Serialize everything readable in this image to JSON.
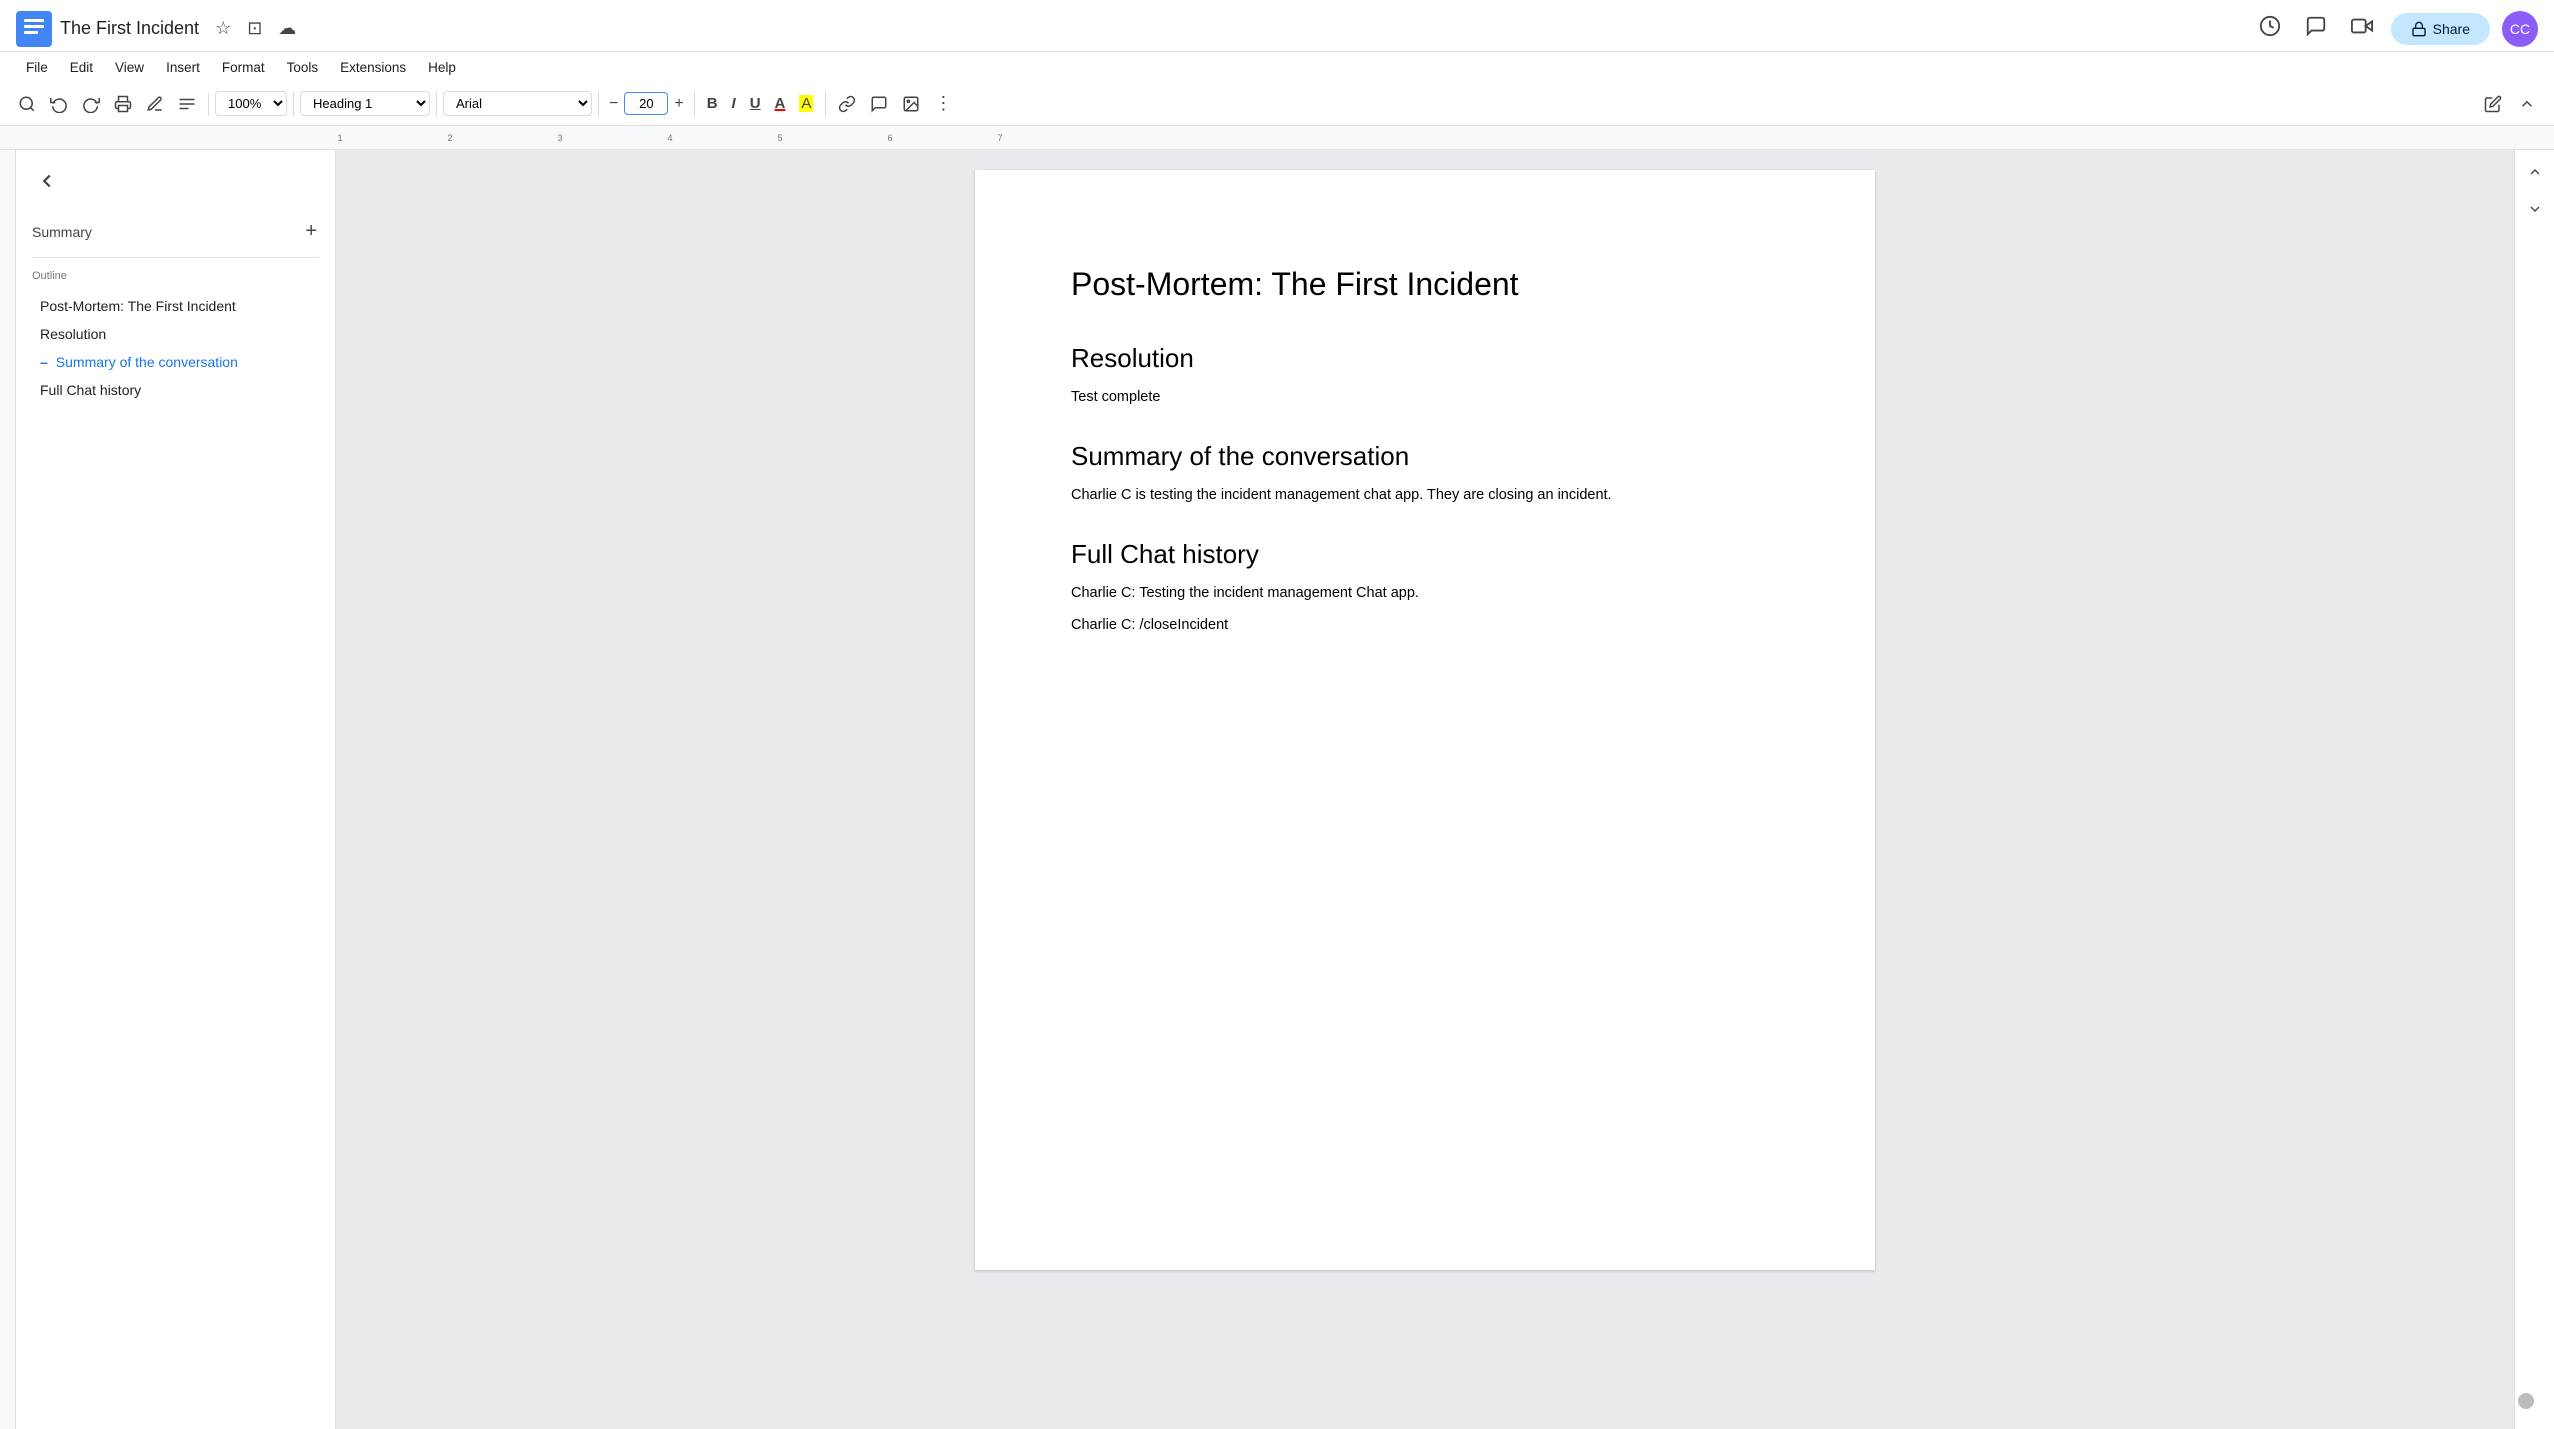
{
  "app": {
    "title": "The First Incident",
    "docs_logo_color": "#4285f4"
  },
  "titlebar": {
    "title": "The First Incident",
    "star_label": "☆",
    "folder_label": "⊡",
    "cloud_label": "☁",
    "history_icon": "history",
    "comment_icon": "comment",
    "video_icon": "video",
    "share_label": "Share",
    "avatar_initials": "CC"
  },
  "menubar": {
    "items": [
      "File",
      "Edit",
      "View",
      "Insert",
      "Format",
      "Tools",
      "Extensions",
      "Help"
    ]
  },
  "toolbar": {
    "search_icon": "🔍",
    "undo_icon": "↩",
    "redo_icon": "↪",
    "print_icon": "🖨",
    "spellcheck_icon": "✓",
    "paint_icon": "🖌",
    "zoom_value": "100%",
    "style_value": "Heading 1",
    "font_value": "Arial",
    "font_size_value": "20",
    "bold_label": "B",
    "italic_label": "I",
    "underline_label": "U",
    "text_color_label": "A",
    "highlight_label": "A",
    "link_icon": "🔗",
    "comment_icon": "💬",
    "image_icon": "🖼",
    "more_icon": "⋮",
    "edit_icon": "✏",
    "collapse_icon": "⌃"
  },
  "sidebar": {
    "back_label": "←",
    "summary_label": "Summary",
    "add_label": "+",
    "outline_label": "Outline",
    "outline_items": [
      {
        "text": "Post-Mortem: The First Incident",
        "active": false
      },
      {
        "text": "Resolution",
        "active": false
      },
      {
        "text": "Summary of the conversation",
        "active": true
      },
      {
        "text": "Full Chat history",
        "active": false
      }
    ]
  },
  "document": {
    "title": "Post-Mortem: The First Incident",
    "sections": [
      {
        "heading": "Resolution",
        "paragraphs": [
          "Test complete"
        ]
      },
      {
        "heading": "Summary of the conversation",
        "paragraphs": [
          "Charlie C is testing the incident management chat app. They are closing an incident."
        ]
      },
      {
        "heading": "Full Chat history",
        "paragraphs": [
          "Charlie C: Testing the incident management Chat app.",
          "Charlie C: /closeIncident"
        ]
      }
    ]
  }
}
